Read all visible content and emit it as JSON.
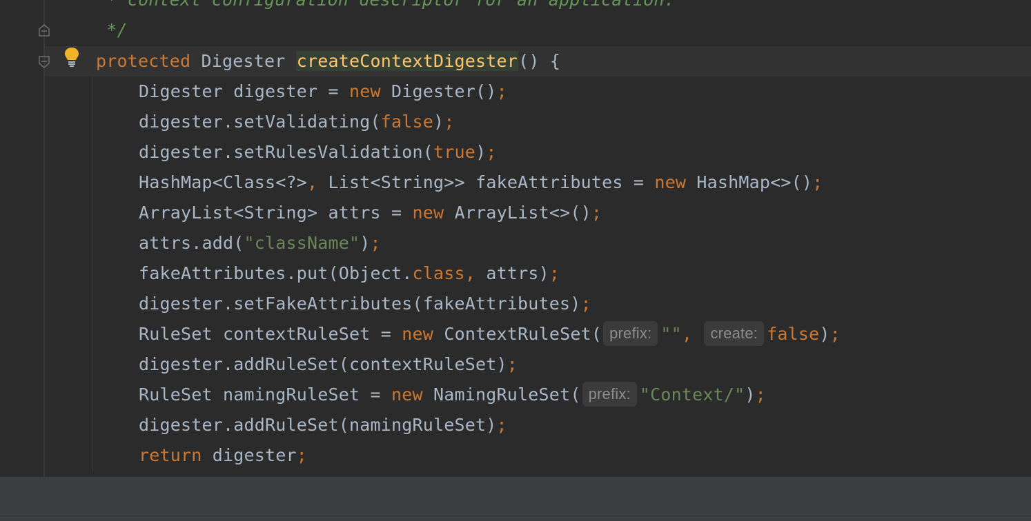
{
  "comment": {
    "line1": " * context configuration descriptor for an application.",
    "line2": " */"
  },
  "signature": {
    "modifier": "protected",
    "return_type": " Digester ",
    "method_name": "createContextDigester",
    "rest": "() {"
  },
  "body": {
    "l1": {
      "a": "Digester digester = ",
      "k": "new",
      "b": " Digester()",
      "s": ";"
    },
    "l2": {
      "a": "digester.setValidating(",
      "k": "false",
      "b": ")",
      "s": ";"
    },
    "l3": {
      "a": "digester.setRulesValidation(",
      "k": "true",
      "b": ")",
      "s": ";"
    },
    "l4": {
      "a": "HashMap<Class<?>",
      "c": ",",
      "b": " List<String>> fakeAttributes = ",
      "k": "new",
      "d": " HashMap<>()",
      "s": ";"
    },
    "l5": {
      "a": "ArrayList<String> attrs = ",
      "k": "new",
      "b": " ArrayList<>()",
      "s": ";"
    },
    "l6": {
      "a": "attrs.add(",
      "str": "\"className\"",
      "b": ")",
      "s": ";"
    },
    "l7": {
      "a": "fakeAttributes.put(Object.",
      "k": "class",
      "c": ",",
      "b": " attrs)",
      "s": ";"
    },
    "l8": {
      "a": "digester.setFakeAttributes(fakeAttributes)",
      "s": ";"
    },
    "l9": {
      "a": "RuleSet contextRuleSet = ",
      "k": "new",
      "b": " ContextRuleSet(",
      "hint1": "prefix:",
      "str": "\"\"",
      "c": ",",
      "hint2": "create:",
      "k2": "false",
      "d": ")",
      "s": ";"
    },
    "l10": {
      "a": "digester.addRuleSet(contextRuleSet)",
      "s": ";"
    },
    "l11": {
      "a": "RuleSet namingRuleSet = ",
      "k": "new",
      "b": " NamingRuleSet(",
      "hint1": "prefix:",
      "str": "\"Context/\"",
      "d": ")",
      "s": ";"
    },
    "l12": {
      "a": "digester.addRuleSet(namingRuleSet)",
      "s": ";"
    },
    "l13": {
      "k": "return",
      "a": " digester",
      "s": ";"
    }
  },
  "icons": [
    "fold-icon",
    "unfold-icon",
    "lightbulb-icon"
  ],
  "colors": {
    "background": "#2b2b2b",
    "keyword": "#cc7832",
    "string": "#6a8759",
    "method": "#ffc66d",
    "comment": "#629755",
    "text": "#a9b7c6"
  }
}
